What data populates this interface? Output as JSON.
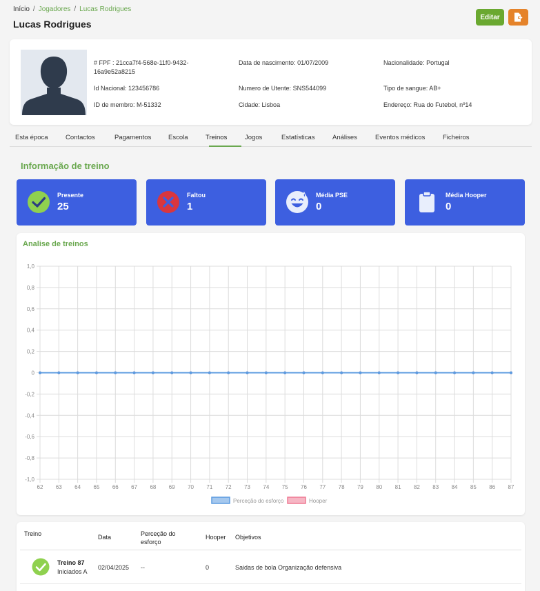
{
  "breadcrumb": {
    "home": "Início",
    "sep": "/",
    "players": "Jogadores",
    "current": "Lucas Rodrigues"
  },
  "page_title": "Lucas Rodrigues",
  "actions": {
    "edit_label": "Editar",
    "export_icon": "export-file-icon"
  },
  "profile": {
    "fpf_label": "# FPF :",
    "fpf_value_1": "21cca7f4-568e-11f0-9432-",
    "fpf_value_2": "16a9e52a8215",
    "id_nacional_label": "Id Nacional:",
    "id_nacional_value": "123456786",
    "id_membro_label": "ID de membro:",
    "id_membro_value": "M-51332",
    "nascimento_label": "Data de nascimento:",
    "nascimento_value": "01/07/2009",
    "utente_label": "Numero de Utente:",
    "utente_value": "SNS544099",
    "cidade_label": "Cidade:",
    "cidade_value": "Lisboa",
    "nacionalidade_label": "Nacionalidade:",
    "nacionalidade_value": "Portugal",
    "sangue_label": "Tipo de sangue:",
    "sangue_value": "AB+",
    "endereco_label": "Endereço:",
    "endereco_value": "Rua do Futebol, nº14"
  },
  "tabs": [
    {
      "label": "Esta época"
    },
    {
      "label": "Contactos"
    },
    {
      "label": "Pagamentos"
    },
    {
      "label": "Escola"
    },
    {
      "label": "Treinos"
    },
    {
      "label": "Jogos"
    },
    {
      "label": "Estatísticas"
    },
    {
      "label": "Análises"
    },
    {
      "label": "Eventos médicos"
    },
    {
      "label": "Ficheiros"
    }
  ],
  "active_tab": "Treinos",
  "section_title": "Informação de treino",
  "stats": [
    {
      "label": "Presente",
      "value": "25",
      "icon": "check-circle-icon"
    },
    {
      "label": "Faltou",
      "value": "1",
      "icon": "x-circle-icon"
    },
    {
      "label": "Média PSE",
      "value": "0",
      "icon": "sweat-smile-icon"
    },
    {
      "label": "Média Hooper",
      "value": "0",
      "icon": "clipboard-icon"
    }
  ],
  "colors": {
    "accent_green": "#6aa84f",
    "stat_blue": "#3d5fe0",
    "edit_green": "#6aa830",
    "export_orange": "#e5832a"
  },
  "chart_title": "Analise de treinos",
  "chart_data": {
    "type": "line",
    "x": [
      62,
      63,
      64,
      65,
      66,
      67,
      68,
      69,
      70,
      71,
      72,
      73,
      74,
      75,
      76,
      77,
      78,
      79,
      80,
      81,
      82,
      83,
      84,
      85,
      86,
      87
    ],
    "y_ticks": [
      "1,0",
      "0,8",
      "0,6",
      "0,4",
      "0,2",
      "0",
      "-0,2",
      "-0,4",
      "-0,6",
      "-0,8",
      "-1,0"
    ],
    "ylim": [
      -1,
      1
    ],
    "grid": true,
    "legend_position": "bottom",
    "series": [
      {
        "name": "Perceção do esforço",
        "color": "#5b9be0",
        "values": [
          0,
          0,
          0,
          0,
          0,
          0,
          0,
          0,
          0,
          0,
          0,
          0,
          0,
          0,
          0,
          0,
          0,
          0,
          0,
          0,
          0,
          0,
          0,
          0,
          0,
          0
        ]
      },
      {
        "name": "Hooper",
        "color": "#ef7a93",
        "values": [
          0,
          0,
          0,
          0,
          0,
          0,
          0,
          0,
          0,
          0,
          0,
          0,
          0,
          0,
          0,
          0,
          0,
          0,
          0,
          0,
          0,
          0,
          0,
          0,
          0,
          0
        ]
      }
    ]
  },
  "table": {
    "headers": {
      "treino": "Treino",
      "data": "Data",
      "pse_1": "Perceção do",
      "pse_2": "esforço",
      "hooper": "Hooper",
      "objetivos": "Objetivos"
    },
    "rows": [
      {
        "name": "Treino 87",
        "group": "Iniciados A",
        "date": "02/04/2025",
        "pse": "--",
        "hooper": "0",
        "objetivos": "Saidas de bola Organização defensiva",
        "icon": "check-circle-icon"
      }
    ]
  }
}
